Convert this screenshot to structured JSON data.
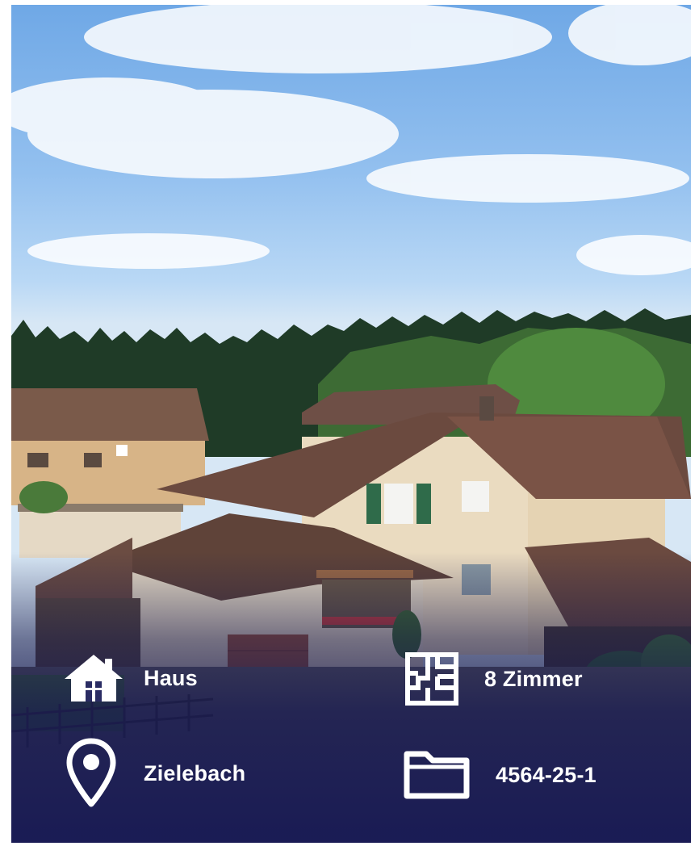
{
  "listing": {
    "type": {
      "label": "Haus",
      "icon": "house-icon"
    },
    "rooms": {
      "label": "8 Zimmer",
      "icon": "floorplan-icon"
    },
    "location": {
      "label": "Zielebach",
      "icon": "location-pin-icon"
    },
    "reference": {
      "label": "4564-25-1",
      "icon": "folder-icon"
    }
  },
  "colors": {
    "overlay": "#16185a",
    "sky": "#8dbcef",
    "text": "#ffffff"
  }
}
